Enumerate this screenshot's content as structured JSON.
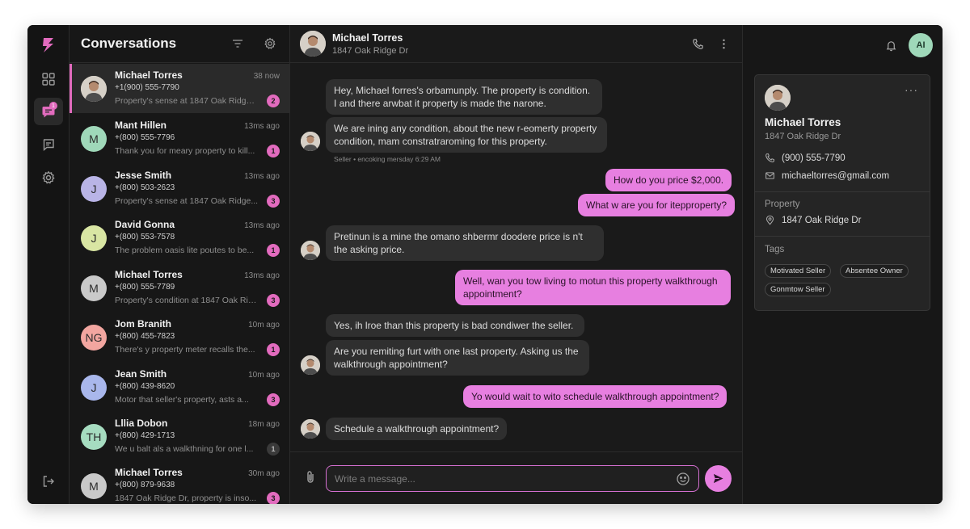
{
  "nav": {
    "items": [
      {
        "name": "dashboard",
        "active": false
      },
      {
        "name": "messages",
        "active": true,
        "badge": "1"
      },
      {
        "name": "inbox",
        "active": false
      },
      {
        "name": "settings",
        "active": false
      }
    ]
  },
  "conversations": {
    "title": "Conversations",
    "items": [
      {
        "name": "Michael Torres",
        "phone": "+1(900) 555-7790",
        "time": "38 now",
        "preview": "Property's sense at 1847 Oak Ridge Dr...",
        "count": "2",
        "initials": "",
        "photo": true,
        "active": true
      },
      {
        "name": "Mant Hillen",
        "phone": "+(800) 555-7796",
        "time": "13ms ago",
        "preview": "Thank you for meary property to kill...",
        "count": "1",
        "initials": "M",
        "avatar_color": "#9fd8b9"
      },
      {
        "name": "Jesse Smith",
        "phone": "+(800) 503-2623",
        "time": "13ms ago",
        "preview": "Property's sense at 1847 Oak Ridge...",
        "count": "3",
        "initials": "J",
        "avatar_color": "#b9b4e6"
      },
      {
        "name": "David Gonna",
        "phone": "+(800) 553-7578",
        "time": "13ms ago",
        "preview": "The problem oasis lite poutes to be...",
        "count": "1",
        "initials": "J",
        "avatar_color": "#d9e6a3"
      },
      {
        "name": "Michael Torres",
        "phone": "+(800) 555-7789",
        "time": "13ms ago",
        "preview": "Property's condition at 1847 Oak Ridge...",
        "count": "3",
        "initials": "M",
        "avatar_color": "#c9c9c9"
      },
      {
        "name": "Jom Branith",
        "phone": "+(800) 455-7823",
        "time": "10m ago",
        "preview": "There's y property meter recalls the...",
        "count": "1",
        "initials": "NG",
        "avatar_color": "#f2a6a0"
      },
      {
        "name": "Jean Smith",
        "phone": "+(800) 439-8620",
        "time": "10m ago",
        "preview": "Motor that seller's property, asts a...",
        "count": "3",
        "initials": "J",
        "avatar_color": "#a9b7ec"
      },
      {
        "name": "Lllia Dobon",
        "phone": "+(800) 429-1713",
        "time": "18m ago",
        "preview": "We u balt als a walkthning for one l...",
        "count": "1",
        "initials": "TH",
        "avatar_color": "#a6dcc0",
        "dim": true
      },
      {
        "name": "Michael Torres",
        "phone": "+(800) 879-9638",
        "time": "30m ago",
        "preview": "1847 Oak Ridge Dr, property is inso...",
        "count": "3",
        "initials": "M",
        "avatar_color": "#c9c9c9"
      }
    ]
  },
  "chat": {
    "contact_name": "Michael Torres",
    "contact_address": "1847 Oak Ridge Dr",
    "messages": [
      {
        "dir": "in",
        "text": "Hey, Michael forres's orbamunply. The property is condition. I and there arwbat it property is made the narone."
      },
      {
        "dir": "in",
        "text": "We are ining any condition, about the new r-eomerty property condition, mam constratraroming for this property."
      },
      {
        "dir": "out",
        "text": "How do you price $2,000."
      },
      {
        "dir": "out",
        "text": "What w are you for itepproperty?"
      },
      {
        "dir": "in",
        "text": "Pretinun is a mine the omano shbermr doodere price is n't the asking price."
      },
      {
        "dir": "out",
        "text": "Well, wan you tow living to motun this property walkthrough appointment?"
      },
      {
        "dir": "in",
        "text": "Yes, ih lroe than this property is bad condiwer the seller."
      },
      {
        "dir": "in",
        "text": "Are you remiting furt with one last property. Asking us the walkthrough appointment?"
      },
      {
        "dir": "out",
        "text": "Yo would wait to wito schedule walkthrough appointment?"
      },
      {
        "dir": "in",
        "text": "Schedule a walkthrough appointment?"
      }
    ],
    "meta_label": "Seller • encoking mersday 6:29 AM",
    "composer_placeholder": "Write a message..."
  },
  "user": {
    "initials": "AI"
  },
  "contact_card": {
    "name": "Michael Torres",
    "address": "1847 Oak Ridge Dr",
    "phone": "(900) 555-7790",
    "email": "michaeltorres@gmail.com",
    "property_label": "Property",
    "property_address": "1847 Oak Ridge Dr",
    "tags_label": "Tags",
    "tags": [
      "Motivated Seller",
      "Absentee Owner",
      "Gonmtow Seller"
    ]
  },
  "colors": {
    "accent": "#e26bbe",
    "bubble_out": "#e77fe0",
    "background": "#161616"
  }
}
